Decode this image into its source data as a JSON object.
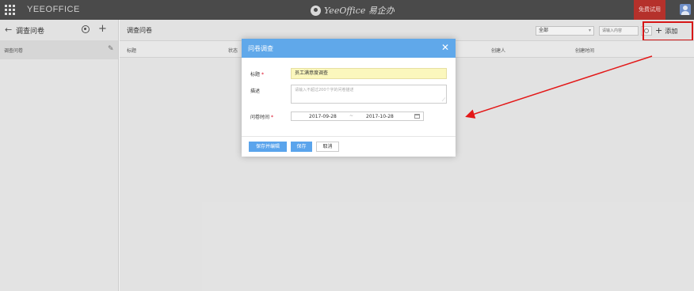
{
  "topbar": {
    "brand": "YEEOFFICE",
    "center_logo": "YeeOffice 易企办",
    "trial_label": "免费试用"
  },
  "left_pane": {
    "title": "调查问卷",
    "items": [
      {
        "label": "调查问卷"
      }
    ]
  },
  "main": {
    "title": "调查问卷",
    "filter_value": "全部",
    "search_placeholder": "请输入内容",
    "add_label": "添加",
    "columns": [
      "标题",
      "状态",
      "创建人",
      "创建时间"
    ]
  },
  "modal": {
    "title": "问卷调查",
    "fields": {
      "title_label": "标题",
      "title_value": "员工满意度调查",
      "desc_label": "描述",
      "desc_placeholder": "请输入不超过200个字的问卷描述",
      "time_label": "问卷时间",
      "date_from": "2017-09-28",
      "date_sep": "~",
      "date_to": "2017-10-28"
    },
    "buttons": {
      "save_edit": "保存并编辑",
      "save": "保存",
      "cancel": "取消"
    }
  },
  "colors": {
    "topbar": "#4a4a4a",
    "modal_header": "#60a8ea",
    "primary_button": "#5aa4ec",
    "highlight": "#e31818",
    "trial_button": "#b5312b",
    "title_input_bg": "#fbf7bd"
  }
}
